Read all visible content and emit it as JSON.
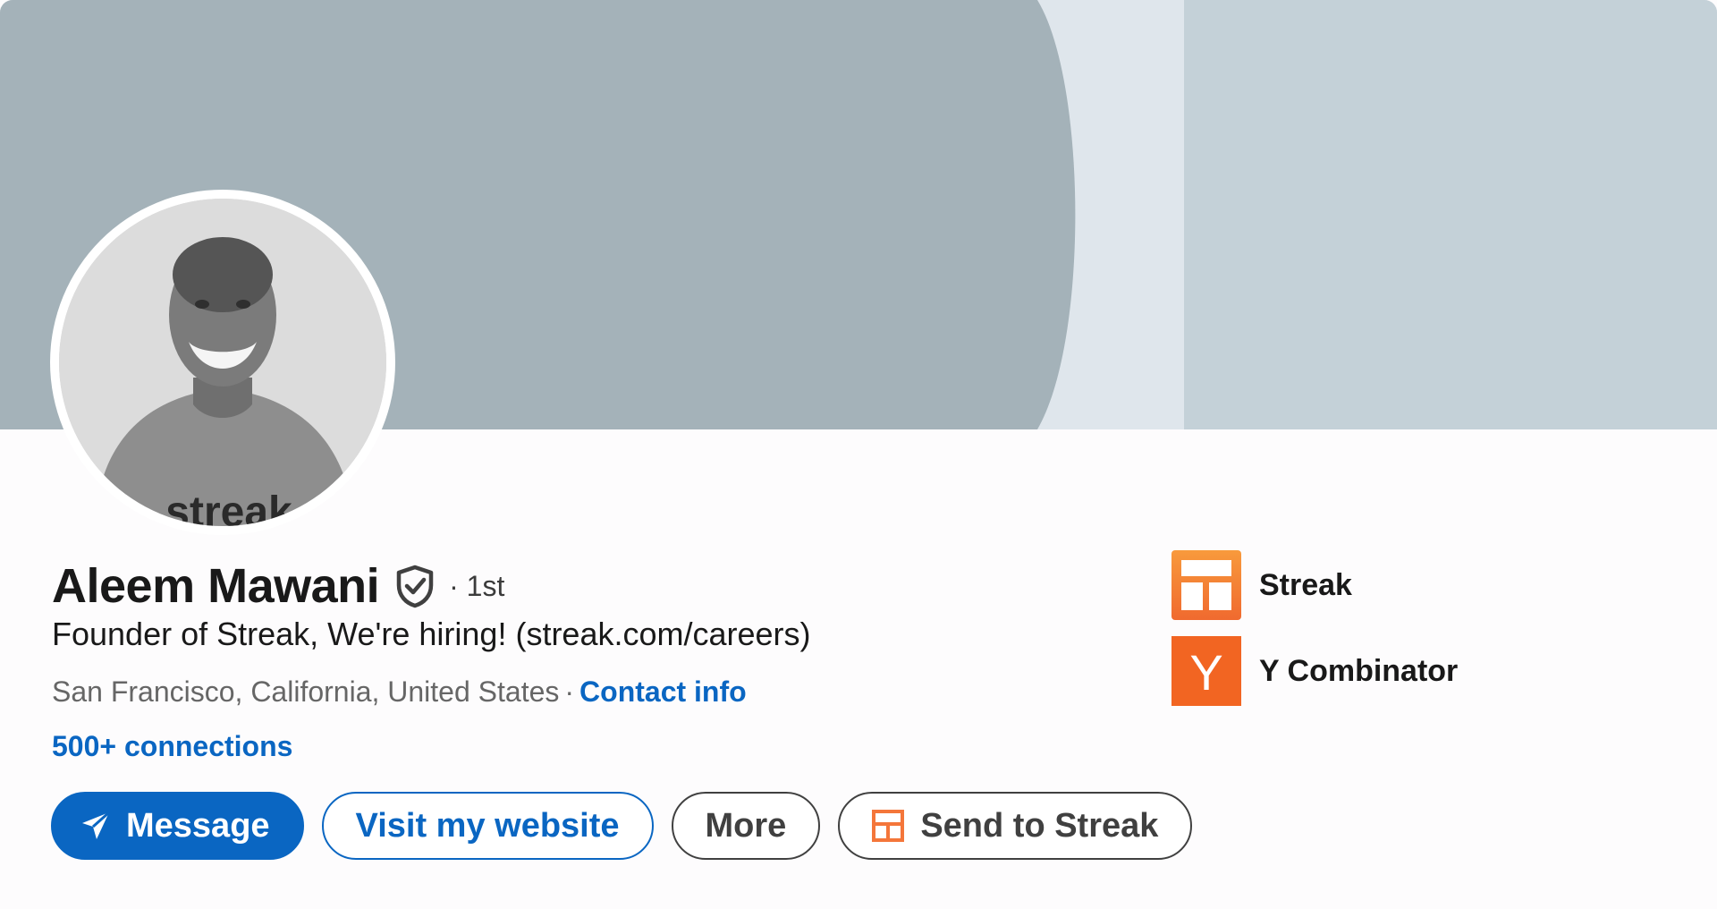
{
  "profile": {
    "name": "Aleem Mawani",
    "degree": "· 1st",
    "headline": "Founder of Streak, We're hiring! (streak.com/careers)",
    "location": "San Francisco, California, United States",
    "separator": "·",
    "contact_info": "Contact info",
    "connections": "500+ connections",
    "shirt_text": "streak"
  },
  "actions": {
    "message": "Message",
    "visit_website": "Visit my website",
    "more": "More",
    "send_to_streak": "Send to Streak"
  },
  "companies": [
    {
      "name": "Streak",
      "logo": "streak-logo",
      "color": "#f4763a"
    },
    {
      "name": "Y Combinator",
      "logo": "y-combinator-logo",
      "logo_letter": "Y",
      "color": "#f26522"
    }
  ],
  "colors": {
    "accent": "#0a66c2",
    "cover_dark": "#a4b2b9",
    "cover_light": "#dfe6ec",
    "cover_right": "#c4d1d8"
  }
}
